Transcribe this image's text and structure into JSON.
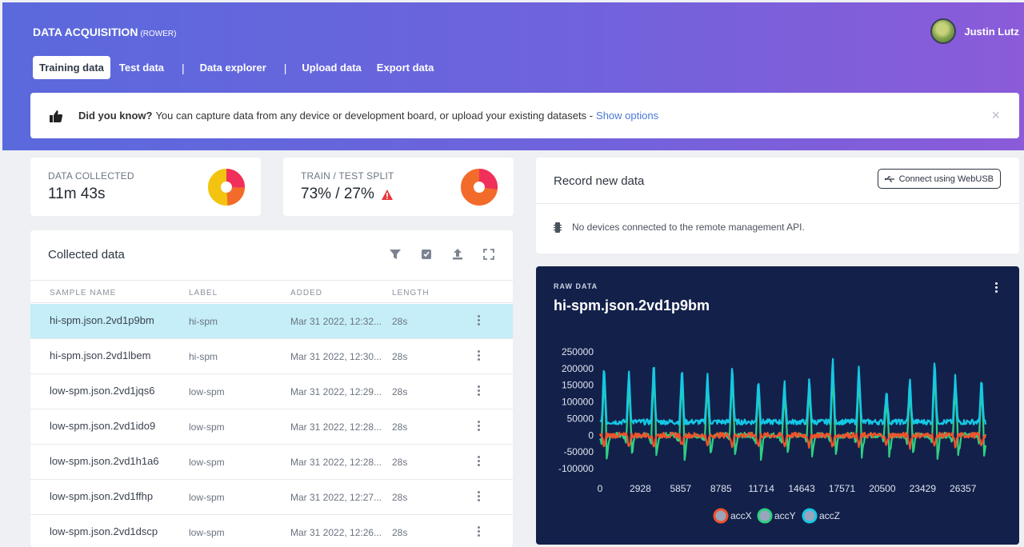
{
  "app": {
    "title": "DATA ACQUISITION",
    "subtitle": "(ROWER)"
  },
  "user": {
    "name": "Justin Lutz"
  },
  "tabs": [
    {
      "label": "Training data",
      "active": true
    },
    {
      "label": "Test data"
    },
    {
      "label": "Data explorer"
    },
    {
      "label": "Upload data"
    },
    {
      "label": "Export data"
    }
  ],
  "tip": {
    "heading": "Did you know?",
    "text": "You can capture data from any device or development board, or upload your existing datasets -",
    "link": "Show options",
    "close": "×"
  },
  "stats": {
    "collected": {
      "label": "DATA COLLECTED",
      "value": "11m 43s"
    },
    "split": {
      "label": "TRAIN / TEST SPLIT",
      "value": "73% / 27%",
      "train_pct": 73,
      "test_pct": 27
    }
  },
  "collected": {
    "title": "Collected data",
    "columns": [
      "SAMPLE NAME",
      "LABEL",
      "ADDED",
      "LENGTH"
    ],
    "rows": [
      {
        "name": "hi-spm.json.2vd1p9bm",
        "label": "hi-spm",
        "added": "Mar 31 2022, 12:32...",
        "length": "28s",
        "selected": true
      },
      {
        "name": "hi-spm.json.2vd1lbem",
        "label": "hi-spm",
        "added": "Mar 31 2022, 12:30...",
        "length": "28s"
      },
      {
        "name": "low-spm.json.2vd1jqs6",
        "label": "low-spm",
        "added": "Mar 31 2022, 12:29...",
        "length": "28s"
      },
      {
        "name": "low-spm.json.2vd1ido9",
        "label": "low-spm",
        "added": "Mar 31 2022, 12:28...",
        "length": "28s"
      },
      {
        "name": "low-spm.json.2vd1h1a6",
        "label": "low-spm",
        "added": "Mar 31 2022, 12:28...",
        "length": "28s"
      },
      {
        "name": "low-spm.json.2vd1ffhp",
        "label": "low-spm",
        "added": "Mar 31 2022, 12:27...",
        "length": "28s"
      },
      {
        "name": "low-spm.json.2vd1dscp",
        "label": "low-spm",
        "added": "Mar 31 2022, 12:26...",
        "length": "28s"
      }
    ]
  },
  "record": {
    "title": "Record new data",
    "button": "Connect using WebUSB",
    "status": "No devices connected to the remote management API."
  },
  "raw": {
    "label": "RAW DATA",
    "title": "hi-spm.json.2vd1p9bm"
  },
  "colors": {
    "accX": "#f0522b",
    "accY": "#2fcf83",
    "accZ": "#14c8e6"
  },
  "chart_data": {
    "type": "line",
    "x_ticks": [
      "0",
      "2928",
      "5857",
      "8785",
      "11714",
      "14643",
      "17571",
      "20500",
      "23429",
      "26357"
    ],
    "y_ticks": [
      "250000",
      "200000",
      "150000",
      "100000",
      "50000",
      "0",
      "-50000",
      "-100000"
    ],
    "ylim": [
      -100000,
      250000
    ],
    "xlim": [
      0,
      28000
    ],
    "series": [
      {
        "name": "accX",
        "color": "#f0522b",
        "baseline": 0,
        "peak": -35000
      },
      {
        "name": "accY",
        "color": "#2fcf83",
        "baseline": 0,
        "peak": 180000
      },
      {
        "name": "accZ",
        "color": "#14c8e6",
        "baseline": 40000,
        "peak": 225000
      }
    ],
    "peak_x": [
      300,
      2100,
      3900,
      5950,
      7800,
      9600,
      11500,
      13400,
      15200,
      16900,
      18800,
      20800,
      22500,
      24300,
      25800,
      27700
    ],
    "peak_y": [
      215000,
      195000,
      230000,
      210000,
      190000,
      220000,
      175000,
      160000,
      175000,
      235000,
      220000,
      140000,
      170000,
      240000,
      180000,
      170000
    ]
  }
}
